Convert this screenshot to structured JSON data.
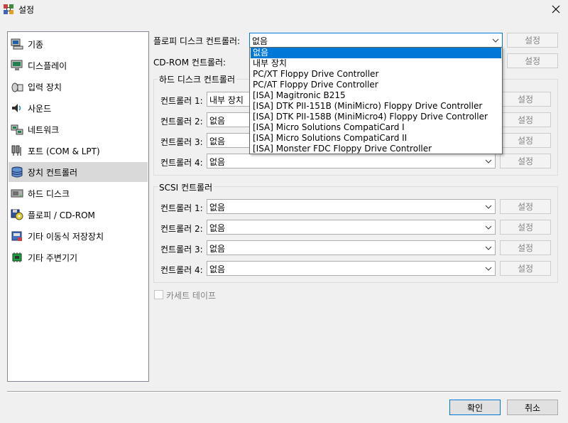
{
  "window": {
    "title": "설정"
  },
  "sidebar": {
    "items": [
      {
        "label": "기종",
        "icon": "machine-icon"
      },
      {
        "label": "디스플레이",
        "icon": "display-icon"
      },
      {
        "label": "입력 장치",
        "icon": "input-device-icon"
      },
      {
        "label": "사운드",
        "icon": "sound-icon"
      },
      {
        "label": "네트워크",
        "icon": "network-icon"
      },
      {
        "label": "포트 (COM & LPT)",
        "icon": "ports-icon"
      },
      {
        "label": "장치 컨트롤러",
        "icon": "storage-controller-icon",
        "selected": true
      },
      {
        "label": "하드 디스크",
        "icon": "hard-disk-icon"
      },
      {
        "label": "플로피 / CD-ROM",
        "icon": "floppy-cdrom-icon"
      },
      {
        "label": "기타 이동식 저장장치",
        "icon": "removable-storage-icon"
      },
      {
        "label": "기타 주변기기",
        "icon": "peripherals-icon"
      }
    ]
  },
  "floppy": {
    "label": "플로피 디스크 컨트롤러:",
    "value": "없음",
    "config_label": "설정"
  },
  "cdrom": {
    "label": "CD-ROM 컨트롤러:",
    "config_label": "설정"
  },
  "hdd": {
    "title": "하드 디스크 컨트롤러",
    "controllers": [
      {
        "label": "컨트롤러 1:",
        "value": "내부 장치",
        "config_label": "설정"
      },
      {
        "label": "컨트롤러 2:",
        "value": "없음",
        "config_label": "설정"
      },
      {
        "label": "컨트롤러 3:",
        "value": "없음",
        "config_label": "설정"
      },
      {
        "label": "컨트롤러 4:",
        "value": "없음",
        "config_label": "설정"
      }
    ]
  },
  "scsi": {
    "title": "SCSI 컨트롤러",
    "controllers": [
      {
        "label": "컨트롤러 1:",
        "value": "없음",
        "config_label": "설정"
      },
      {
        "label": "컨트롤러 2:",
        "value": "없음",
        "config_label": "설정"
      },
      {
        "label": "컨트롤러 3:",
        "value": "없음",
        "config_label": "설정"
      },
      {
        "label": "컨트롤러 4:",
        "value": "없음",
        "config_label": "설정"
      }
    ]
  },
  "cassette": {
    "label": "카세트 테이프",
    "checked": false
  },
  "dropdown": {
    "options": [
      "없음",
      "내부 장치",
      "PC/XT Floppy Drive Controller",
      "PC/AT Floppy Drive Controller",
      "[ISA] Magitronic B215",
      "[ISA] DTK PII-151B (MiniMicro) Floppy Drive Controller",
      "[ISA] DTK PII-158B (MiniMicro4) Floppy Drive Controller",
      "[ISA] Micro Solutions CompatiCard I",
      "[ISA] Micro Solutions CompatiCard II",
      "[ISA] Monster FDC Floppy Drive Controller"
    ],
    "selected_index": 0
  },
  "footer": {
    "ok_label": "확인",
    "cancel_label": "취소"
  },
  "colors": {
    "accent": "#0078d7",
    "selection_bg": "#d9d9d9"
  }
}
